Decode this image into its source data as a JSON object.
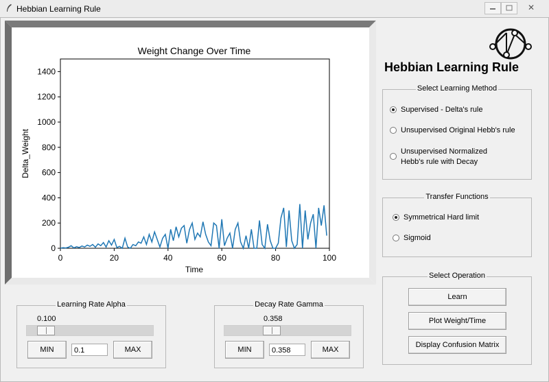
{
  "window": {
    "title": "Hebbian Learning Rule",
    "close_glyph": "✕"
  },
  "app": {
    "title": "Hebbian Learning Rule"
  },
  "learning_method": {
    "title": "Select Learning Method",
    "options": [
      {
        "label": "Supervised - Delta's rule",
        "selected": true
      },
      {
        "label": "Unsupervised Original Hebb's rule",
        "selected": false
      },
      {
        "label": "Unsupervised Normalized\nHebb's rule with Decay",
        "selected": false
      }
    ]
  },
  "transfer": {
    "title": "Transfer Functions",
    "options": [
      {
        "label": "Symmetrical Hard limit",
        "selected": true
      },
      {
        "label": "Sigmoid",
        "selected": false
      }
    ]
  },
  "operation": {
    "title": "Select Operation",
    "learn": "Learn",
    "plot": "Plot Weight/Time",
    "confusion": "Display Confusion Matrix"
  },
  "alpha": {
    "title": "Learning Rate Alpha",
    "value_label": "0.100",
    "value": 0.1,
    "entry": "0.1",
    "min": "MIN",
    "max": "MAX"
  },
  "gamma": {
    "title": "Decay Rate Gamma",
    "value_label": "0.358",
    "value": 0.358,
    "entry": "0.358",
    "min": "MIN",
    "max": "MAX"
  },
  "chart_data": {
    "type": "line",
    "title": "Weight Change Over Time",
    "xlabel": "Time",
    "ylabel": "Delta_Weight",
    "xlim": [
      0,
      100
    ],
    "ylim": [
      0,
      1500
    ],
    "xticks": [
      0,
      20,
      40,
      60,
      80,
      100
    ],
    "yticks": [
      0,
      200,
      400,
      600,
      800,
      1000,
      1200,
      1400
    ],
    "grid": false,
    "color": "#1f77b4",
    "x": [
      0,
      1,
      2,
      3,
      4,
      5,
      6,
      7,
      8,
      9,
      10,
      11,
      12,
      13,
      14,
      15,
      16,
      17,
      18,
      19,
      20,
      21,
      22,
      23,
      24,
      25,
      26,
      27,
      28,
      29,
      30,
      31,
      32,
      33,
      34,
      35,
      36,
      37,
      38,
      39,
      40,
      41,
      42,
      43,
      44,
      45,
      46,
      47,
      48,
      49,
      50,
      51,
      52,
      53,
      54,
      55,
      56,
      57,
      58,
      59,
      60,
      61,
      62,
      63,
      64,
      65,
      66,
      67,
      68,
      69,
      70,
      71,
      72,
      73,
      74,
      75,
      76,
      77,
      78,
      79,
      80,
      81,
      82,
      83,
      84,
      85,
      86,
      87,
      88,
      89,
      90,
      91,
      92,
      93,
      94,
      95,
      96,
      97,
      98,
      99
    ],
    "y": [
      0,
      5,
      2,
      8,
      20,
      3,
      12,
      6,
      18,
      10,
      25,
      15,
      30,
      8,
      35,
      20,
      45,
      10,
      60,
      25,
      70,
      5,
      15,
      0,
      80,
      10,
      0,
      30,
      20,
      50,
      40,
      90,
      30,
      110,
      50,
      130,
      70,
      10,
      80,
      110,
      0,
      150,
      60,
      170,
      90,
      160,
      180,
      40,
      150,
      200,
      70,
      120,
      90,
      210,
      110,
      50,
      20,
      200,
      180,
      0,
      230,
      20,
      80,
      120,
      0,
      150,
      200,
      50,
      0,
      100,
      0,
      150,
      0,
      0,
      220,
      30,
      0,
      190,
      60,
      0,
      0,
      40,
      240,
      320,
      10,
      300,
      60,
      0,
      30,
      350,
      0,
      300,
      70,
      200,
      270,
      0,
      320,
      180,
      340,
      100
    ]
  }
}
